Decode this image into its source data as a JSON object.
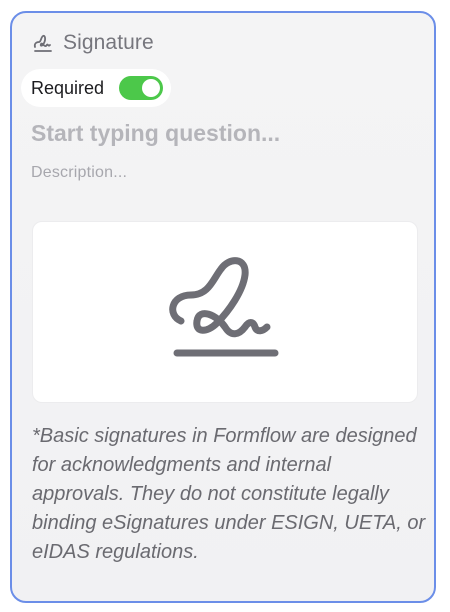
{
  "field": {
    "type_icon": "signature-icon",
    "type_label": "Signature",
    "required_label": "Required",
    "required_enabled": true,
    "question_placeholder": "Start typing question...",
    "description_placeholder": "Description...",
    "signature_pad_icon": "signature-icon",
    "disclaimer": "*Basic signatures in Formflow are designed for acknowledgments and internal approvals. They do not constitute legally binding eSignatures under ESIGN, UETA, or eIDAS regulations."
  },
  "colors": {
    "card_border": "#6b8ee8",
    "toggle_on": "#4cc84a"
  }
}
